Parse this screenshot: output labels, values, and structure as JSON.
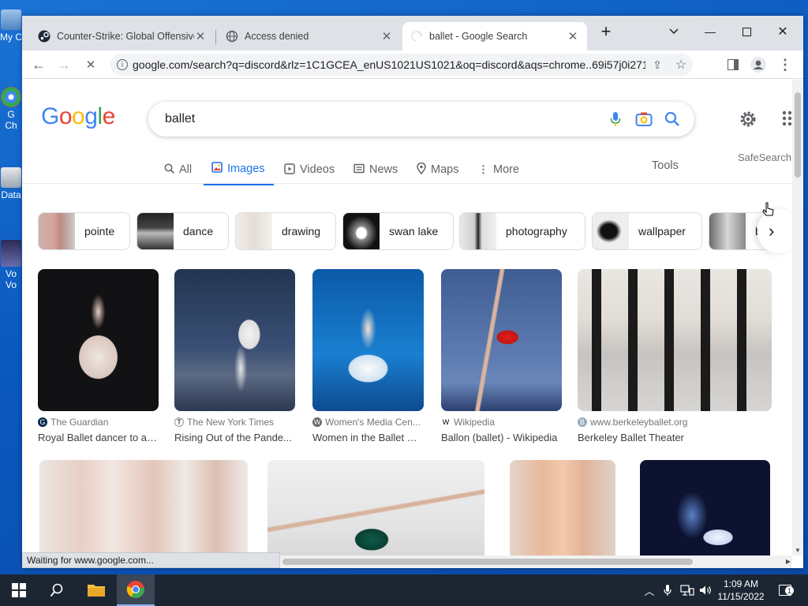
{
  "desktop": {
    "icons": [
      {
        "label": "My C"
      },
      {
        "label": "G\nCh"
      },
      {
        "label": "Data"
      },
      {
        "label": "Vo\nVo"
      }
    ]
  },
  "browser": {
    "tabs": [
      {
        "title": "Counter-Strike: Global Offensive",
        "favicon": "steam-icon",
        "active": false
      },
      {
        "title": "Access denied",
        "favicon": "globe-icon",
        "active": false
      },
      {
        "title": "ballet - Google Search",
        "favicon": "loading-spinner-icon",
        "active": true
      }
    ],
    "url": "google.com/search?q=discord&rlz=1C1GCEA_enUS1021US1021&oq=discord&aqs=chrome..69i57j0i271l2...",
    "status_text": "Waiting for www.google.com..."
  },
  "google": {
    "logo": [
      "G",
      "o",
      "o",
      "g",
      "l",
      "e"
    ],
    "logo_colors": [
      "#4285f4",
      "#ea4335",
      "#fbbc05",
      "#4285f4",
      "#34a853",
      "#ea4335"
    ],
    "query": "ballet",
    "tabs": [
      {
        "label": "All",
        "icon": "search-icon"
      },
      {
        "label": "Images",
        "icon": "image-icon",
        "active": true
      },
      {
        "label": "Videos",
        "icon": "play-icon"
      },
      {
        "label": "News",
        "icon": "newspaper-icon"
      },
      {
        "label": "Maps",
        "icon": "map-pin-icon"
      },
      {
        "label": "More",
        "icon": "kebab-icon"
      }
    ],
    "tools": "Tools",
    "safesearch": "SafeSearch",
    "chips": [
      "pointe",
      "dance",
      "drawing",
      "swan lake",
      "photography",
      "wallpaper",
      "b"
    ],
    "results": [
      {
        "source": "The Guardian",
        "title": "Royal Ballet dancer to au...",
        "fav": "G"
      },
      {
        "source": "The New York Times",
        "title": "Rising Out of the Pande...",
        "fav": "T"
      },
      {
        "source": "Women's Media Cen...",
        "title": "Women in the Ballet W...",
        "fav": "W"
      },
      {
        "source": "Wikipedia",
        "title": "Ballon (ballet) - Wikipedia",
        "fav": "W"
      },
      {
        "source": "www.berkeleyballet.org",
        "title": "Berkeley Ballet Theater",
        "fav": "B"
      }
    ]
  },
  "taskbar": {
    "time": "1:09 AM",
    "date": "11/15/2022",
    "notification_count": "1"
  }
}
